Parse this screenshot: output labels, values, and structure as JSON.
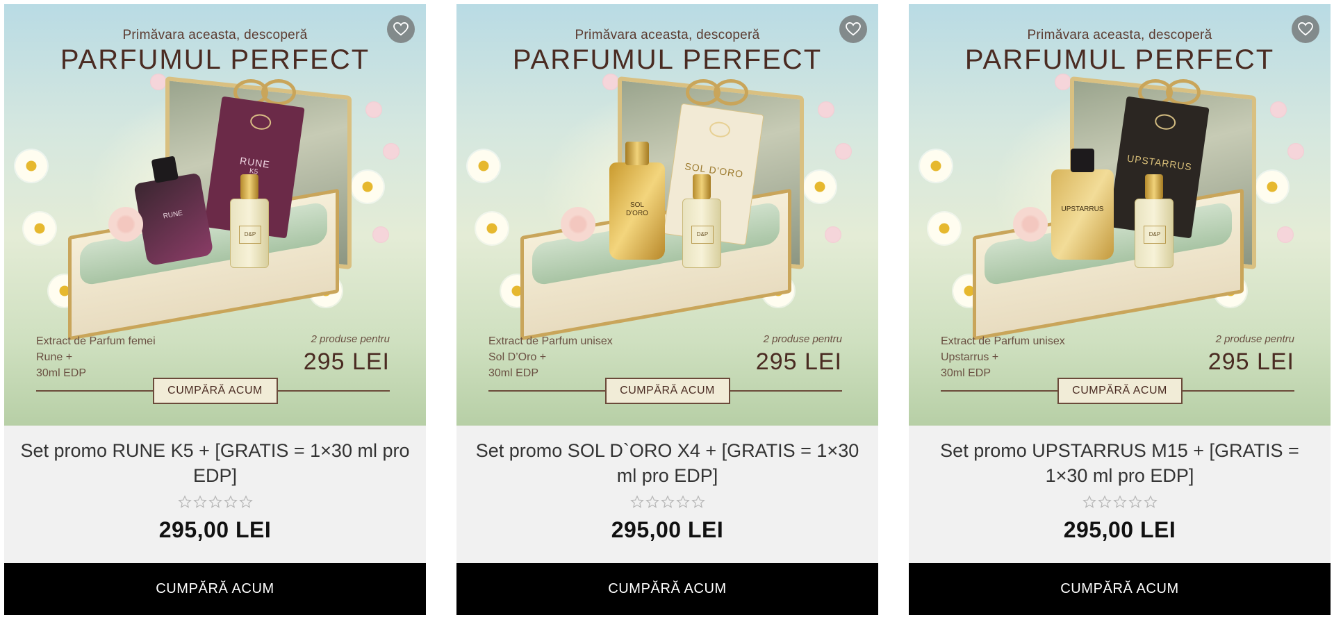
{
  "products": [
    {
      "banner": {
        "tagline": "Primăvara aceasta, descoperă",
        "headline": "PARFUMUL PERFECT",
        "desc_line1": "Extract de Parfum femei",
        "desc_line2": "Rune +",
        "desc_line3": "30ml EDP",
        "offer_small": "2 produse pentru",
        "offer_price": "295 LEI",
        "cta": "CUMPĂRĂ ACUM",
        "box_label": "RUNE",
        "box_sub": "K5",
        "bottle_label": "RUNE",
        "box_color": "#6b2a48",
        "bottle_color": "#3a2630",
        "bottle_accent": "#8a3c66"
      },
      "title": "Set promo RUNE K5 + [GRATIS = 1×30 ml pro EDP]",
      "price": "295,00 LEI",
      "buy_label": "CUMPĂRĂ ACUM"
    },
    {
      "banner": {
        "tagline": "Primăvara aceasta, descoperă",
        "headline": "PARFUMUL PERFECT",
        "desc_line1": "Extract de Parfum unisex",
        "desc_line2": "Sol D’Oro +",
        "desc_line3": "30ml EDP",
        "offer_small": "2 produse pentru",
        "offer_price": "295 LEI",
        "cta": "CUMPĂRĂ ACUM",
        "box_label": "SOL D'ORO",
        "box_sub": "",
        "bottle_label": "SOL D'ORO",
        "box_color": "#f2ead5",
        "bottle_color": "#c99a2e",
        "bottle_accent": "#f3d57d"
      },
      "title": "Set promo SOL D`ORO X4 + [GRATIS = 1×30 ml pro EDP]",
      "price": "295,00 LEI",
      "buy_label": "CUMPĂRĂ ACUM"
    },
    {
      "banner": {
        "tagline": "Primăvara aceasta, descoperă",
        "headline": "PARFUMUL PERFECT",
        "desc_line1": "Extract de Parfum unisex",
        "desc_line2": "Upstarrus +",
        "desc_line3": "30ml EDP",
        "offer_small": "2 produse pentru",
        "offer_price": "295 LEI",
        "cta": "CUMPĂRĂ ACUM",
        "box_label": "UPSTARRUS",
        "box_sub": "",
        "bottle_label": "UPSTARRUS",
        "box_color": "#2b2622",
        "bottle_color": "#d8b45a",
        "bottle_accent": "#f2dc98"
      },
      "title": "Set promo UPSTARRUS M15 + [GRATIS = 1×30 ml pro EDP]",
      "price": "295,00 LEI",
      "buy_label": "CUMPĂRĂ ACUM"
    }
  ],
  "rating": {
    "stars_filled": 0,
    "stars_total": 5
  },
  "icons": {
    "favorite": "heart-icon",
    "star": "star-outline-icon"
  }
}
